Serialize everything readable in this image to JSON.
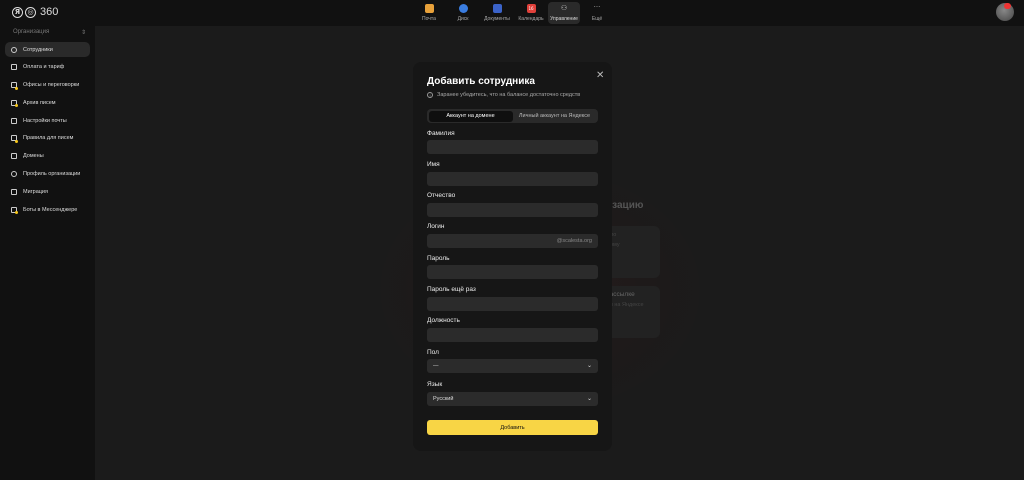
{
  "header": {
    "logo_text": "360",
    "apps": [
      {
        "label": "Почта",
        "color": "#e8a13a"
      },
      {
        "label": "Диск",
        "color": "#3a7de0"
      },
      {
        "label": "Документы",
        "color": "#3b63c9"
      },
      {
        "label": "Календарь",
        "color": "#e0403a",
        "badge": "16"
      },
      {
        "label": "Управление",
        "color": "#cccccc"
      },
      {
        "label": "Ещё",
        "color": "#888888"
      }
    ]
  },
  "sidebar": {
    "org_label": "Организация",
    "items": [
      {
        "label": "Сотрудники",
        "icon": "person-icon"
      },
      {
        "label": "Оплата и тариф",
        "icon": "grid-icon"
      },
      {
        "label": "Офисы и переговорки",
        "icon": "office-icon"
      },
      {
        "label": "Архив писем",
        "icon": "archive-icon"
      },
      {
        "label": "Настройки почты",
        "icon": "mail-settings-icon"
      },
      {
        "label": "Правила для писем",
        "icon": "rules-icon"
      },
      {
        "label": "Домены",
        "icon": "domain-icon"
      },
      {
        "label": "Профиль организации",
        "icon": "gear-icon"
      },
      {
        "label": "Миграция",
        "icon": "migration-icon"
      },
      {
        "label": "Боты в Мессенджере",
        "icon": "bot-icon"
      }
    ]
  },
  "background": {
    "title_fragment": "изацию",
    "card1_a": "ло",
    "card1_b": "ому",
    "card2_a": "рассылке",
    "card2_b": "ом на Яндексе"
  },
  "modal": {
    "title": "Добавить сотрудника",
    "hint": "Заранее убедитесь, что на балансе достаточно средств",
    "segments": [
      "Аккаунт на домене",
      "Личный аккаунт на Яндексе"
    ],
    "fields": {
      "last_name": "Фамилия",
      "first_name": "Имя",
      "middle_name": "Отчество",
      "login": "Логин",
      "login_suffix": "@scalesta.org",
      "password": "Пароль",
      "password_repeat": "Пароль ещё раз",
      "position": "Должность",
      "gender": "Пол",
      "gender_value": "—",
      "language": "Язык",
      "language_value": "Русский"
    },
    "submit_label": "Добавить"
  }
}
